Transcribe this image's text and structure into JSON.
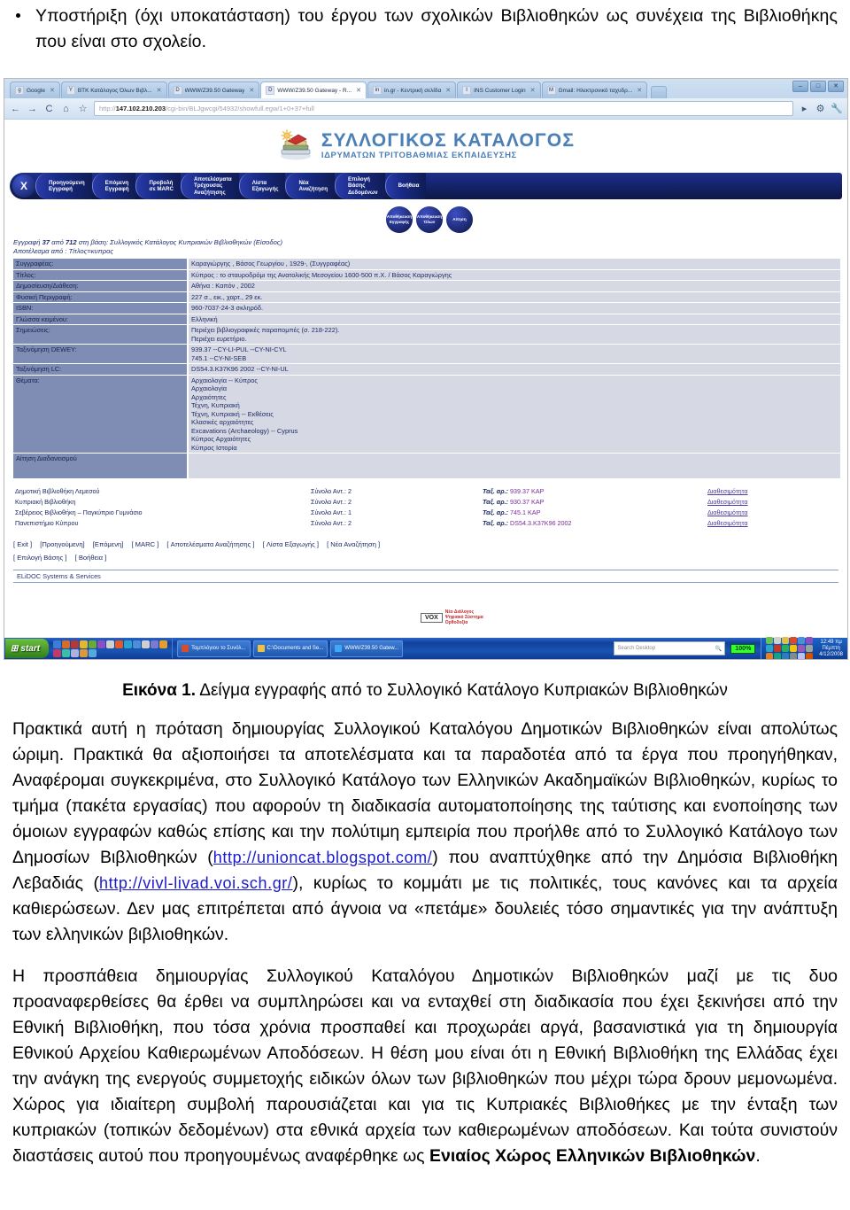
{
  "top_bullets": [
    "Υποστήριξη (όχι υποκατάσταση) του έργου των σχολικών Βιβλιοθηκών ως συνέχεια της Βιβλιοθήκης που είναι στο σχολείο."
  ],
  "browser": {
    "tabs": [
      {
        "title": "Google",
        "favicon": "g",
        "active": false
      },
      {
        "title": "ΒΤΚ Κατάλογος Όλων Βιβλ...",
        "favicon": "Y",
        "active": false
      },
      {
        "title": "WWW/Z39.50 Gateway",
        "favicon": "D",
        "active": false
      },
      {
        "title": "WWW/Z39.50 Gateway - R...",
        "favicon": "D",
        "active": true
      },
      {
        "title": "in.gr - Κεντρική σελίδα",
        "favicon": "in",
        "active": false
      },
      {
        "title": "INS Customer Login",
        "favicon": "I",
        "active": false
      },
      {
        "title": "Gmail: Ηλεκτρονικό ταχυδρ...",
        "favicon": "M",
        "active": false
      }
    ],
    "new_tab_label": "+",
    "window_buttons": [
      "–",
      "□",
      "✕"
    ],
    "nav_icons": {
      "back": "←",
      "forward": "→",
      "reload": "C",
      "home": "⌂",
      "bookmark": "☆",
      "menu_page": "▸",
      "menu_tools": "⚙",
      "wrench": "🔧"
    },
    "url_prefix": "http://",
    "url_host": "147.102.210.203",
    "url_rest": "/cgi-bin/BLJgwcgi/54932/showfull.egw/1+0+37+full"
  },
  "site": {
    "logo_main": "ΣΥΛΛΟΓΙΚΟΣ ΚΑΤΑΛΟΓΟΣ",
    "logo_sub": "ΙΔΡΥΜΑΤΩΝ ΤΡΙΤΟΒΑΘΜΙΑΣ ΕΚΠΑΙΔΕΥΣΗΣ",
    "toolbar": {
      "close_label": "X",
      "buttons": [
        "Προηγούμενη\nΕγγραφή",
        "Επόμενη\nΕγγραφή",
        "Προβολή\nσε MARC",
        "Αποτελέσματα\nΤρέχουσας\nΑναζήτησης",
        "Λίστα\nΕξαγωγής",
        "Νέα\nΑναζήτηση",
        "Επιλογή\nΒάσης\nΔεδομένων",
        "Βοήθεια"
      ]
    },
    "circle_buttons": [
      "Αποθήκευση\nΕγγραφής",
      "Αποθήκευση\nΌλων",
      "Αίτηση"
    ],
    "record_meta_line1_prefix": "Εγγραφή ",
    "record_number": "37",
    "record_meta_mid": " από ",
    "record_total": "712",
    "record_meta_suffix": " στη βάση: Συλλογικός Κατάλογος Κυπριακών Βιβλιοθηκών (Είσοδος)",
    "record_meta_line2": "Αποτέλεσμα από : Τίτλος=κυπρος",
    "record_fields": [
      {
        "label": "Συγγραφέας:",
        "value": "Καραγιώργης , Βάσος Γεωργίου , 1929-, (Συγγραφέας)"
      },
      {
        "label": "Τίτλος:",
        "value": "Κύπρος :  το σταυροδρόμι της Ανατολικής Μεσογείου 1600-500 π.Χ. / Βάσος Καραγιώργης"
      },
      {
        "label": "Δημοσίευση/Διάθεση:",
        "value": "Αθήνα : Καπόν , 2002"
      },
      {
        "label": "Φυσική Περιγραφή:",
        "value": "227 σ., εικ., χαρτ., 29 εκ."
      },
      {
        "label": "ISBN:",
        "value": "960-7037-24-3 σκληρόδ."
      },
      {
        "label": "Γλώσσα κειμένου:",
        "value": "Ελληνική"
      },
      {
        "label": "Σημειώσεις:",
        "value": "Περιέχει βιβλιογραφικές παραπομπές (σ. 218-222).\nΠεριέχει ευρετήριο."
      },
      {
        "label": "Ταξινόμηση DEWEY:",
        "value": "939.37 --CY-LI-PUL --CY-NI-CYL\n745.1 --CY-NI-SEB"
      },
      {
        "label": "Ταξινόμηση LC:",
        "value": "DS54.3.K37K96 2002 --CY-NI-UL"
      },
      {
        "label": "Θέματα:",
        "value": "Αρχαιολογία -- Κύπρος\nΑρχαιολογία\nΑρχαιότητες\nΤέχνη, Κυπριακή\nΤέχνη, Κυπριακή -- Εκθέσεις\nΚλασικές αρχαιότητες\nExcavations (Archaeology) -- Cyprus\nΚύπρος Αρχαιότητες\nΚύπρος Ιστορία"
      },
      {
        "label": "Αίτηση Διαδανεισμού",
        "value": ""
      }
    ],
    "vox_badge": {
      "box": "VOX",
      "line1": "Νέο Διάλογος",
      "line2": "Ψηφιακό Σύστημα",
      "line3": "Ορθοδοξία"
    },
    "holdings_headers": [
      "",
      "",
      "",
      ""
    ],
    "holdings": [
      {
        "library": "Δημοτική Βιβλιοθήκη Λεμεσού",
        "count_label": "Σύνολο Αντ.:",
        "count": "2",
        "call_label": "Ταξ. αρ.:",
        "call": "939.37 KAP",
        "availability": "Διαθεσιμότητα"
      },
      {
        "library": "Κυπριακή Βιβλιοθήκη",
        "count_label": "Σύνολο Αντ.:",
        "count": "2",
        "call_label": "Ταξ. αρ.:",
        "call": "930.37 KAP",
        "availability": "Διαθεσιμότητα"
      },
      {
        "library": "Σεβέρειος Βιβλιοθήκη – Παγκύπριο Γυμνάσιο",
        "count_label": "Σύνολο Αντ.:",
        "count": "1",
        "call_label": "Ταξ. αρ.:",
        "call": "745.1 ΚΑΡ",
        "availability": "Διαθεσιμότητα"
      },
      {
        "library": "Πανεπιστήμιο Κύπρου",
        "count_label": "Σύνολο Αντ.:",
        "count": "2",
        "call_label": "Ταξ. αρ.:",
        "call": "DS54.3.K37K96 2002",
        "availability": "Διαθεσιμότητα"
      }
    ],
    "footer_links_row1": [
      "[ Exit ]",
      "[Προηγούμενη]",
      "[Επόμενη]",
      "[ MARC ]",
      "[ Αποτελέσματα Αναζήτησης ]",
      "[ Λίστα Εξαγωγής ]",
      "[ Νέα Αναζήτηση ]"
    ],
    "footer_links_row2": [
      "[ Επιλογή Βάσης ]",
      "[ Βοήθεια ]"
    ],
    "footer_brand": "ELiDOC Systems & Services"
  },
  "taskbar": {
    "start_label": "start",
    "tasks": [
      {
        "label": "Ταμπλόγιου το Συνόλ...",
        "color": "#d94b2a"
      },
      {
        "label": "C:\\Documents and Se...",
        "color": "#f0c040"
      },
      {
        "label": "WWW/Z39.50 Gatew...",
        "color": "#3fa9f5"
      }
    ],
    "desktop_search_placeholder": "Search Desktop",
    "zoom_level": "100%",
    "clock_time": "12:49 πμ",
    "clock_day": "Πέμπτη",
    "clock_date": "4/12/2008"
  },
  "caption": {
    "prefix": "Εικόνα 1.",
    "text": " Δείγμα εγγραφής από το Συλλογικό Κατάλογο Κυπριακών Βιβλιοθηκών"
  },
  "paragraphs": {
    "p1_a": "Πρακτικά αυτή η πρόταση δημιουργίας Συλλογικού Καταλόγου Δημοτικών Βιβλιοθηκών είναι απολύτως ώριμη. Πρακτικά θα αξιοποιήσει τα αποτελέσματα και τα παραδοτέα από τα έργα που προηγήθηκαν, Αναφέρομαι συγκεκριμένα, στο Συλλογικό Κατάλογο των Ελληνικών Ακαδημαϊκών Βιβλιοθηκών, κυρίως το τμήμα (πακέτα εργασίας) που αφορούν τη διαδικασία αυτοματοποίησης της ταύτισης και ενοποίησης των όμοιων εγγραφών καθώς επίσης και την πολύτιμη εμπειρία που προήλθε από το Συλλογικό Κατάλογο των Δημοσίων Βιβλιοθηκών (",
    "link1": "http://unioncat.blogspot.com/",
    "p1_b": ") που αναπτύχθηκε από την Δημόσια Βιβλιοθήκη Λεβαδιάς (",
    "link2": "http://vivl-livad.voi.sch.gr/",
    "p1_c": "), κυρίως το κομμάτι με τις πολιτικές, τους κανόνες και τα αρχεία καθιερώσεων. Δεν μας επιτρέπεται από άγνοια να «πετάμε» δουλειές τόσο σημαντικές για την ανάπτυξη των ελληνικών βιβλιοθηκών.",
    "p2_a": "Η προσπάθεια δημιουργίας Συλλογικού Καταλόγου Δημοτικών Βιβλιοθηκών μαζί με τις δυο προαναφερθείσες θα έρθει να συμπληρώσει και να ενταχθεί στη διαδικασία που έχει ξεκινήσει από την Εθνική Βιβλιοθήκη, που τόσα χρόνια προσπαθεί  και προχωράει αργά, βασανιστικά  για τη δημιουργία Εθνικού Αρχείου Καθιερωμένων Αποδόσεων.  Η θέση μου είναι ότι η Εθνική Βιβλιοθήκη της Ελλάδας έχει την ανάγκη της ενεργούς συμμετοχής ειδικών όλων των βιβλιοθηκών που μέχρι τώρα δρουν μεμονωμένα. Χώρος για ιδιαίτερη συμβολή παρουσιάζεται και για τις Κυπριακές Βιβλιοθήκες με την ένταξη των κυπριακών (τοπικών δεδομένων) στα εθνικά αρχεία των καθιερωμένων αποδόσεων. Και τούτα συνιστούν διαστάσεις αυτού που προηγουμένως αναφέρθηκε ως ",
    "p2_bold": "Ενιαίος Χώρος Ελληνικών Βιβλιοθηκών",
    "p2_b": "."
  }
}
